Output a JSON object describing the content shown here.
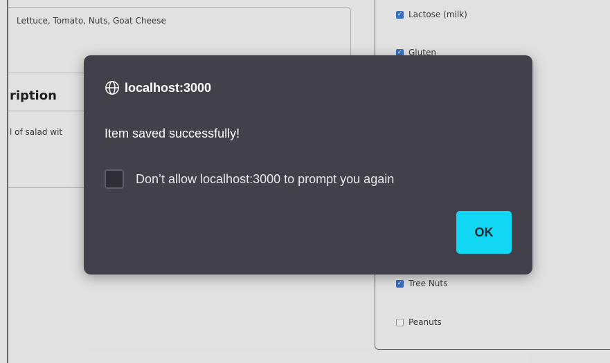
{
  "form": {
    "ingredients_value": "Lettuce, Tomato, Nuts, Goat Cheese",
    "description_heading": "ription",
    "description_value": "l of salad wit"
  },
  "allergens": [
    {
      "label": "Lactose (milk)",
      "checked": true
    },
    {
      "label": "Gluten",
      "checked": true
    },
    {
      "label": "Tree Nuts",
      "checked": true
    },
    {
      "label": "Peanuts",
      "checked": false
    }
  ],
  "dialog": {
    "origin": "localhost:3000",
    "message": "Item saved successfully!",
    "suppress_label": "Don’t allow localhost:3000 to prompt you again",
    "ok_label": "OK",
    "icon": "globe-icon"
  },
  "colors": {
    "dialog_bg": "#42404b",
    "ok_button": "#11d7f5",
    "checkbox_checked": "#3b73c8"
  }
}
